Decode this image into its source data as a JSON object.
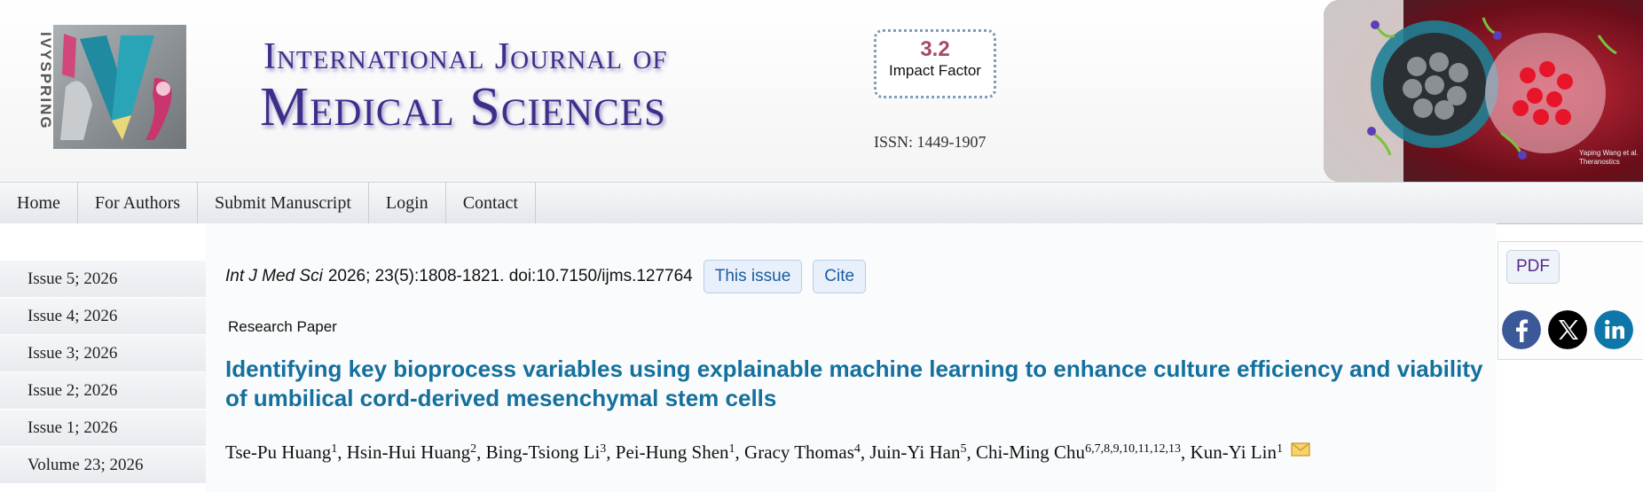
{
  "header": {
    "logo_text": "IVYSPRING",
    "journal_line1": "International Journal of",
    "journal_line2": "Medical Sciences",
    "impact": {
      "value": "3.2",
      "label": "Impact Factor"
    },
    "issn": "ISSN: 1449-1907",
    "cover_credit": "Yaping Wang et al. Theranostics"
  },
  "nav": {
    "items": [
      "Home",
      "For Authors",
      "Submit Manuscript",
      "Login",
      "Contact"
    ]
  },
  "sidebar": {
    "items": [
      "Issue 5; 2026",
      "Issue 4; 2026",
      "Issue 3; 2026",
      "Issue 2; 2026",
      "Issue 1; 2026",
      "Volume 23; 2026"
    ]
  },
  "article": {
    "journal_abbr": "Int J Med Sci",
    "citation": "2026; 23(5):1808-1821. doi:10.7150/ijms.127764",
    "this_issue_label": "This issue",
    "cite_label": "Cite",
    "paper_type": "Research Paper",
    "title": "Identifying key bioprocess variables using explainable machine learning to enhance culture efficiency and viability of umbilical cord-derived mesenchymal stem cells",
    "authors": [
      {
        "name": "Tse-Pu Huang",
        "aff": "1"
      },
      {
        "name": "Hsin-Hui Huang",
        "aff": "2"
      },
      {
        "name": "Bing-Tsiong Li",
        "aff": "3"
      },
      {
        "name": "Pei-Hung Shen",
        "aff": "1"
      },
      {
        "name": "Gracy Thomas",
        "aff": "4"
      },
      {
        "name": "Juin-Yi Han",
        "aff": "5"
      },
      {
        "name": "Chi-Ming Chu",
        "aff": "6,7,8,9,10,11,12,13"
      },
      {
        "name": "Kun-Yi Lin",
        "aff": "1"
      }
    ],
    "separator": ", "
  },
  "right_panel": {
    "pdf_label": "PDF",
    "social_icons": [
      "facebook-icon",
      "x-icon",
      "linkedin-icon"
    ]
  },
  "colors": {
    "title_blue": "#14709d",
    "journal_purple": "#3c2f8a",
    "impact_red": "#a64b61",
    "pill_text": "#1d5a9e"
  }
}
